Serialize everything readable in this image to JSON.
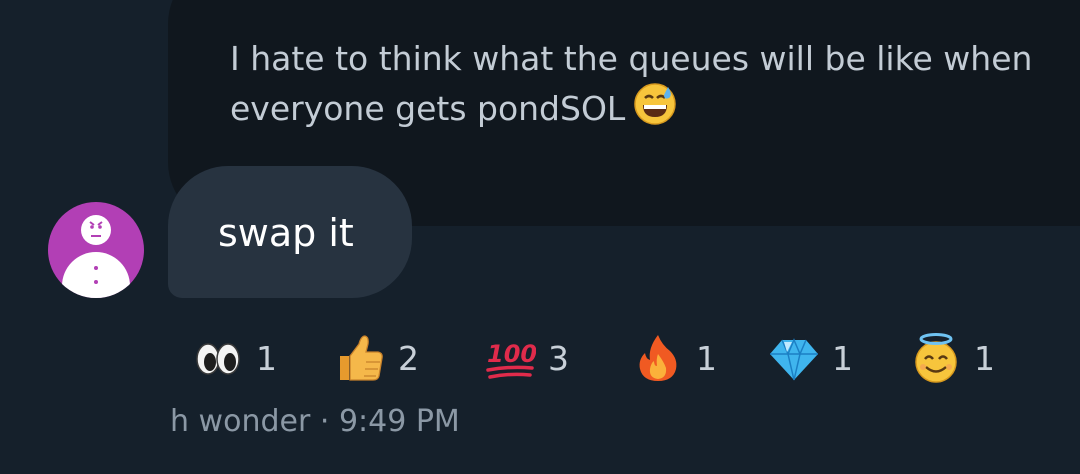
{
  "quoted_message": {
    "line1": "I hate to think what the queues will be like when",
    "line2": "everyone gets pondSOL",
    "emoji_icon": "grinning-sweat-emoji-icon"
  },
  "message": {
    "text": "swap it",
    "avatar_icon": "snowman-avatar-icon"
  },
  "reactions": [
    {
      "icon": "eyes-emoji-icon",
      "count": "1"
    },
    {
      "icon": "thumbs-up-emoji-icon",
      "count": "2"
    },
    {
      "icon": "hundred-points-emoji-icon",
      "count": "3"
    },
    {
      "icon": "fire-emoji-icon",
      "count": "1"
    },
    {
      "icon": "gem-stone-emoji-icon",
      "count": "1"
    },
    {
      "icon": "halo-smile-emoji-icon",
      "count": "1"
    }
  ],
  "meta": {
    "sender": "h wonder",
    "separator": "·",
    "time": "9:49 PM"
  },
  "colors": {
    "background": "#15202b",
    "quoted_bubble": "#10171e",
    "message_bubble": "#273340",
    "avatar": "#b23fb5"
  }
}
